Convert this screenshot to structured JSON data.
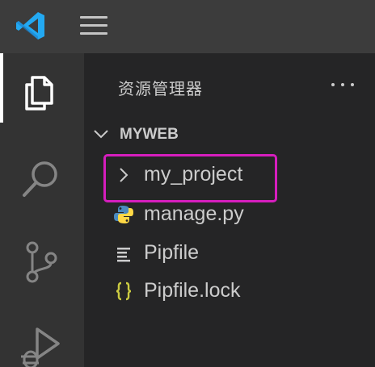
{
  "app": {
    "logo_icon": "vscode-logo",
    "menu_icon": "hamburger-menu-icon"
  },
  "activity_bar": {
    "items": [
      {
        "icon": "explorer-files-icon",
        "active": true
      },
      {
        "icon": "search-icon",
        "active": false
      },
      {
        "icon": "source-control-icon",
        "active": false
      },
      {
        "icon": "run-debug-icon",
        "active": false
      }
    ]
  },
  "explorer": {
    "title": "资源管理器",
    "more_icon": "more-actions-icon",
    "workspace": {
      "name": "MYWEB",
      "expanded": true,
      "items": [
        {
          "label": "my_project",
          "type": "folder",
          "icon": "chevron-right-icon",
          "highlighted": true
        },
        {
          "label": "manage.py",
          "type": "file",
          "icon": "python-file-icon"
        },
        {
          "label": "Pipfile",
          "type": "file",
          "icon": "text-file-icon"
        },
        {
          "label": "Pipfile.lock",
          "type": "file",
          "icon": "json-braces-icon"
        }
      ]
    }
  },
  "colors": {
    "highlight_border": "#d61ebe",
    "vscode_blue": "#23a9f2",
    "python_blue": "#4b8bbe",
    "python_yellow": "#ffd845",
    "json_yellow": "#cbcb41"
  }
}
